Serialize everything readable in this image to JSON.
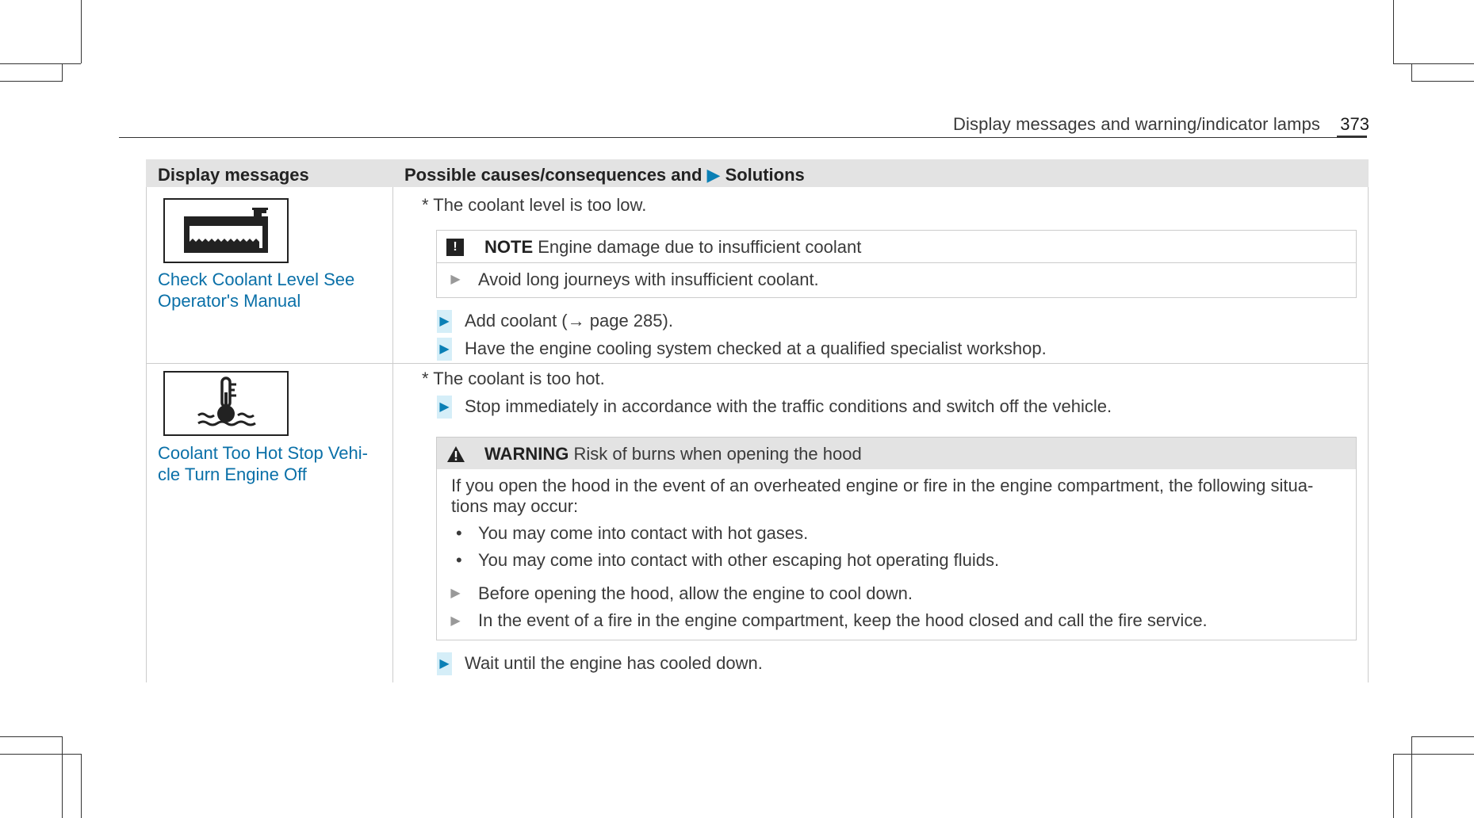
{
  "header": {
    "section_title": "Display messages and warning/indicator lamps",
    "page_number": "373"
  },
  "table": {
    "col_headers": {
      "display_messages": "Display messages",
      "causes_prefix": "Possible causes/consequences and",
      "solutions_marker": "▶",
      "solutions": "Solutions"
    },
    "rows": [
      {
        "icon": "coolant-level-icon",
        "message_line1": "Check Coolant Level See",
        "message_line2": "Operator's Manual",
        "cause": "* The coolant level is too low.",
        "note": {
          "icon_glyph": "!",
          "label": "NOTE",
          "title": "Engine damage due to insufficient coolant",
          "step": "Avoid long journeys with insufficient coolant."
        },
        "steps": [
          "Add coolant (→ page 285).",
          "Have the engine cooling system checked at a qualified specialist workshop."
        ]
      },
      {
        "icon": "coolant-temperature-icon",
        "message_line1": "Coolant Too Hot Stop Vehi-",
        "message_line2": "cle Turn Engine Off",
        "cause": "* The coolant is too hot.",
        "step_first": "Stop immediately in accordance with the traffic conditions and switch off the vehicle.",
        "warning": {
          "label": "WARNING",
          "title": "Risk of burns when opening the hood",
          "body_line1": "If you open the hood in the event of an overheated engine or fire in the engine compartment, the following situa-",
          "body_line2": "tions may occur:",
          "bullets": [
            "You may come into contact with hot gases.",
            "You may come into contact with other escaping hot operating fluids."
          ],
          "steps": [
            "Before opening the hood, allow the engine to cool down.",
            "In the event of a fire in the engine compartment, keep the hood closed and call the fire service."
          ]
        },
        "step_last": "Wait until the engine has cooled down."
      }
    ]
  },
  "colors": {
    "link_blue": "#0a70a8",
    "arrow_blue": "#0a7fb5",
    "arrow_bg": "#d5eef8",
    "header_bg": "#e3e3e3"
  }
}
